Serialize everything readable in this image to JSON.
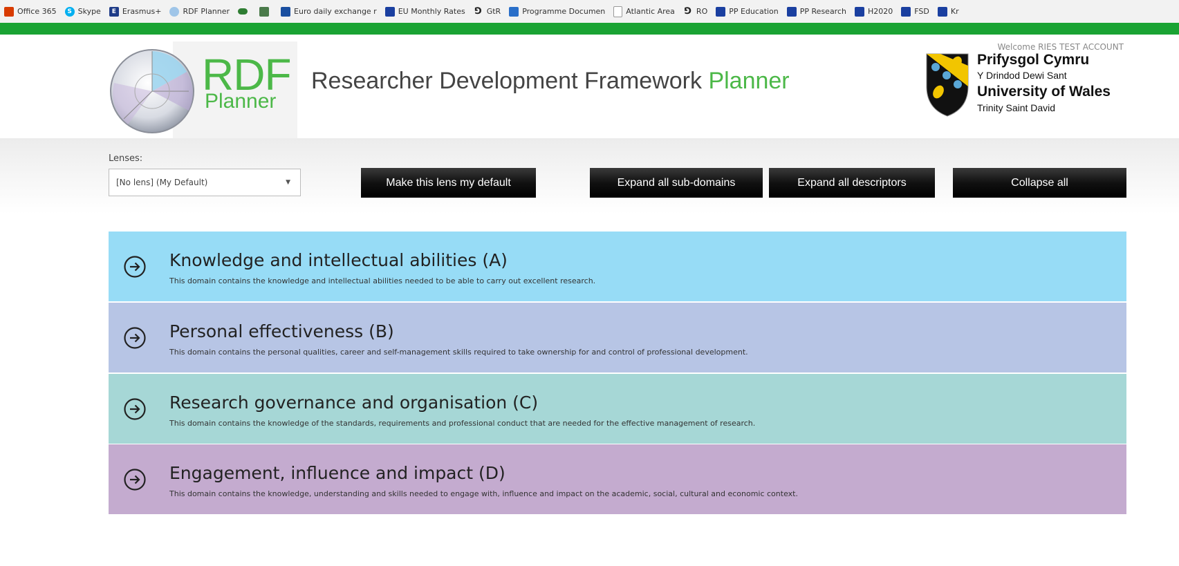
{
  "bookmarks": [
    {
      "label": "Office 365",
      "icon": "office-icon",
      "color": "#d83b01"
    },
    {
      "label": "Skype",
      "icon": "skype-icon",
      "color": "#00aff0"
    },
    {
      "label": "Erasmus+",
      "icon": "erasmus-icon",
      "color": "#1f3c88"
    },
    {
      "label": "RDF Planner",
      "icon": "rdf-icon",
      "color": "#9fc5e8"
    },
    {
      "label": "",
      "icon": "link-icon",
      "color": "#2e7d32"
    },
    {
      "label": "",
      "icon": "image-icon",
      "color": "#4a7a4a"
    },
    {
      "label": "Euro daily exchange r",
      "icon": "euro-icon",
      "color": "#1a4fa0"
    },
    {
      "label": "EU Monthly Rates",
      "icon": "eu-icon",
      "color": "#1a3fa0"
    },
    {
      "label": "GtR",
      "icon": "gtr-icon",
      "color": "#222222"
    },
    {
      "label": "Programme Documen",
      "icon": "document-icon",
      "color": "#2a6fc9"
    },
    {
      "label": "Atlantic Area",
      "icon": "page-icon",
      "color": "#bbbbbb"
    },
    {
      "label": "RO",
      "icon": "ro-icon",
      "color": "#222222"
    },
    {
      "label": "PP Education",
      "icon": "pp-icon",
      "color": "#1a3fa0"
    },
    {
      "label": "PP Research",
      "icon": "pp-icon",
      "color": "#1a3fa0"
    },
    {
      "label": "H2020",
      "icon": "eu-icon",
      "color": "#1a3fa0"
    },
    {
      "label": "FSD",
      "icon": "eu-icon",
      "color": "#1a3fa0"
    },
    {
      "label": "Kr",
      "icon": "eu-icon",
      "color": "#1a3fa0"
    }
  ],
  "header": {
    "logo_rdf": "RDF",
    "logo_planner": "Planner",
    "title_main": "Researcher Development Framework",
    "title_accent": "Planner",
    "welcome": "Welcome RIES TEST ACCOUNT",
    "uni_line1": "Prifysgol Cymru",
    "uni_line2": "Y Drindod Dewi Sant",
    "uni_line3": "University of Wales",
    "uni_line4": "Trinity Saint David"
  },
  "lens": {
    "label": "Lenses:",
    "selected": "[No lens] (My Default)"
  },
  "buttons": {
    "make_default": "Make this lens my default",
    "expand_sub": "Expand all sub-domains",
    "expand_desc": "Expand all descriptors",
    "collapse": "Collapse all"
  },
  "domains": [
    {
      "title": "Knowledge and intellectual abilities (A)",
      "description": "This domain contains the knowledge and intellectual abilities needed to be able to carry out excellent research.",
      "color": "#97dcf6"
    },
    {
      "title": "Personal effectiveness (B)",
      "description": "This domain contains the personal qualities, career and self-management skills required to take ownership for and control of professional development.",
      "color": "#b7c5e5"
    },
    {
      "title": "Research governance and organisation (C)",
      "description": "This domain contains the knowledge of the standards, requirements and professional conduct that are needed for the effective management of research.",
      "color": "#a6d7d6"
    },
    {
      "title": "Engagement, influence and impact (D)",
      "description": "This domain contains the knowledge, understanding and skills needed to engage with, influence and impact on the academic, social, cultural and economic context.",
      "color": "#c4abcf"
    }
  ],
  "colors": {
    "accent_green": "#4cb848",
    "topbar_green": "#1aa333"
  }
}
